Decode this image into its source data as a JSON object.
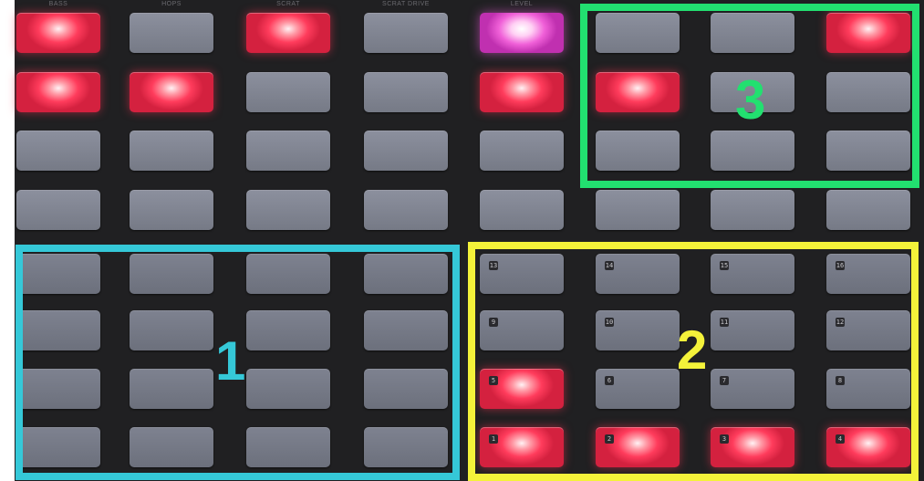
{
  "column_labels": [
    "BASS",
    "HOPS",
    "SCRAT",
    "SCRAT DRIVE",
    "LEVEL"
  ],
  "colors": {
    "pad_off": "#828694",
    "pad_red": "#ff3c5c",
    "pad_pink": "#f060d8",
    "group1": "#35c8d8",
    "group2": "#f4f23a",
    "group3": "#22e070",
    "background": "#202022"
  },
  "groups": [
    {
      "label": "1",
      "color": "#35c8d8"
    },
    {
      "label": "2",
      "color": "#f4f23a"
    },
    {
      "label": "3",
      "color": "#22e070"
    }
  ],
  "grid": {
    "rows": 8,
    "cols": 8,
    "states": [
      [
        "red",
        "off",
        "red",
        "off",
        "pink",
        "off",
        "off",
        "red"
      ],
      [
        "red",
        "red",
        "off",
        "off",
        "red",
        "red",
        "off",
        "off"
      ],
      [
        "off",
        "off",
        "off",
        "off",
        "off",
        "off",
        "off",
        "off"
      ],
      [
        "off",
        "off",
        "off",
        "off",
        "off",
        "off",
        "off",
        "off"
      ],
      [
        "off",
        "off",
        "off",
        "off",
        "off",
        "off",
        "off",
        "off"
      ],
      [
        "off",
        "off",
        "off",
        "off",
        "off",
        "off",
        "off",
        "off"
      ],
      [
        "off",
        "off",
        "off",
        "off",
        "red",
        "off",
        "off",
        "off"
      ],
      [
        "off",
        "off",
        "off",
        "off",
        "red",
        "red",
        "red",
        "red"
      ]
    ],
    "pad_numbers": [
      null,
      null,
      null,
      null,
      null,
      null,
      null,
      null,
      null,
      null,
      null,
      null,
      null,
      null,
      null,
      null,
      null,
      null,
      null,
      null,
      null,
      null,
      null,
      null,
      null,
      null,
      null,
      null,
      null,
      null,
      null,
      null,
      null,
      null,
      null,
      null,
      "13",
      "14",
      "15",
      "16",
      null,
      null,
      null,
      null,
      "9",
      "10",
      "11",
      "12",
      null,
      null,
      null,
      null,
      "5",
      "6",
      "7",
      "8",
      null,
      null,
      null,
      null,
      "1",
      "2",
      "3",
      "4"
    ]
  }
}
